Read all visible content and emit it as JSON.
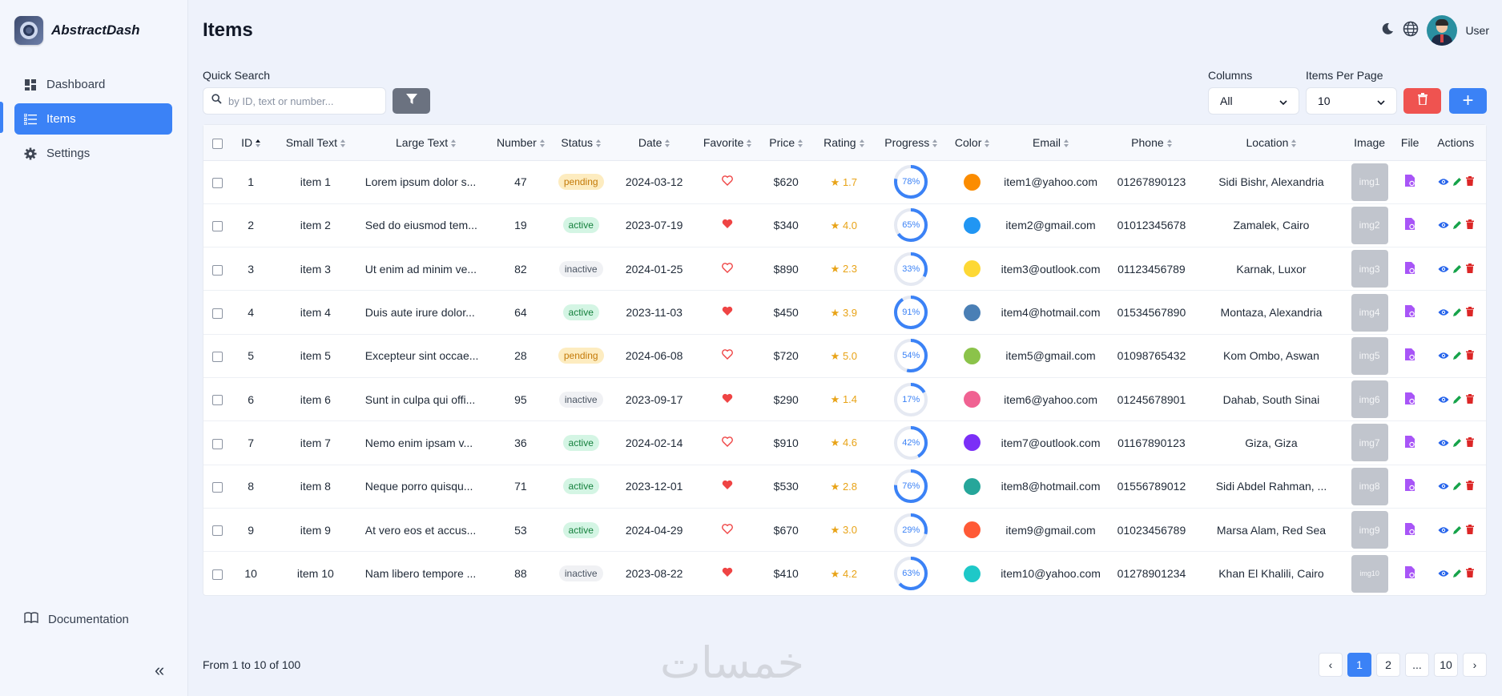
{
  "app": {
    "name": "AbstractDash"
  },
  "sidebar": {
    "items": [
      {
        "label": "Dashboard",
        "icon": "dashboard-icon",
        "active": false
      },
      {
        "label": "Items",
        "icon": "list-icon",
        "active": true
      },
      {
        "label": "Settings",
        "icon": "gear-icon",
        "active": false
      }
    ],
    "documentation_label": "Documentation",
    "collapse_icon": "«"
  },
  "header": {
    "title": "Items",
    "user_name": "User"
  },
  "toolbar": {
    "quick_search_label": "Quick Search",
    "search_placeholder": "by ID, text or number...",
    "columns_label": "Columns",
    "columns_value": "All",
    "per_page_label": "Items Per Page",
    "per_page_value": "10",
    "add_label": "+"
  },
  "table": {
    "headers": {
      "id": "ID",
      "small_text": "Small Text",
      "large_text": "Large Text",
      "number": "Number",
      "status": "Status",
      "date": "Date",
      "favorite": "Favorite",
      "price": "Price",
      "rating": "Rating",
      "progress": "Progress",
      "color": "Color",
      "email": "Email",
      "phone": "Phone",
      "location": "Location",
      "image": "Image",
      "file": "File",
      "actions": "Actions"
    },
    "rows": [
      {
        "id": "1",
        "small": "item 1",
        "large": "Lorem ipsum dolor s...",
        "number": "47",
        "status": "pending",
        "date": "2024-03-12",
        "favorite": false,
        "price": "$620",
        "rating": "1.7",
        "progress": 78,
        "progress_label": "78%",
        "color": "#fb8c00",
        "email": "item1@yahoo.com",
        "phone": "01267890123",
        "location": "Sidi Bishr, Alexandria",
        "image": "img1"
      },
      {
        "id": "2",
        "small": "item 2",
        "large": "Sed do eiusmod tem...",
        "number": "19",
        "status": "active",
        "date": "2023-07-19",
        "favorite": true,
        "price": "$340",
        "rating": "4.0",
        "progress": 65,
        "progress_label": "65%",
        "color": "#2196f3",
        "email": "item2@gmail.com",
        "phone": "01012345678",
        "location": "Zamalek, Cairo",
        "image": "img2"
      },
      {
        "id": "3",
        "small": "item 3",
        "large": "Ut enim ad minim ve...",
        "number": "82",
        "status": "inactive",
        "date": "2024-01-25",
        "favorite": false,
        "price": "$890",
        "rating": "2.3",
        "progress": 33,
        "progress_label": "33%",
        "color": "#fdd835",
        "email": "item3@outlook.com",
        "phone": "01123456789",
        "location": "Karnak, Luxor",
        "image": "img3"
      },
      {
        "id": "4",
        "small": "item 4",
        "large": "Duis aute irure dolor...",
        "number": "64",
        "status": "active",
        "date": "2023-11-03",
        "favorite": true,
        "price": "$450",
        "rating": "3.9",
        "progress": 91,
        "progress_label": "91%",
        "color": "#4a7fb5",
        "email": "item4@hotmail.com",
        "phone": "01534567890",
        "location": "Montaza, Alexandria",
        "image": "img4"
      },
      {
        "id": "5",
        "small": "item 5",
        "large": "Excepteur sint occae...",
        "number": "28",
        "status": "pending",
        "date": "2024-06-08",
        "favorite": false,
        "price": "$720",
        "rating": "5.0",
        "progress": 54,
        "progress_label": "54%",
        "color": "#8bc34a",
        "email": "item5@gmail.com",
        "phone": "01098765432",
        "location": "Kom Ombo, Aswan",
        "image": "img5"
      },
      {
        "id": "6",
        "small": "item 6",
        "large": "Sunt in culpa qui offi...",
        "number": "95",
        "status": "inactive",
        "date": "2023-09-17",
        "favorite": true,
        "price": "$290",
        "rating": "1.4",
        "progress": 17,
        "progress_label": "17%",
        "color": "#f06292",
        "email": "item6@yahoo.com",
        "phone": "01245678901",
        "location": "Dahab, South Sinai",
        "image": "img6"
      },
      {
        "id": "7",
        "small": "item 7",
        "large": "Nemo enim ipsam v...",
        "number": "36",
        "status": "active",
        "date": "2024-02-14",
        "favorite": false,
        "price": "$910",
        "rating": "4.6",
        "progress": 42,
        "progress_label": "42%",
        "color": "#7b2ff7",
        "email": "item7@outlook.com",
        "phone": "01167890123",
        "location": "Giza, Giza",
        "image": "img7"
      },
      {
        "id": "8",
        "small": "item 8",
        "large": "Neque porro quisqu...",
        "number": "71",
        "status": "active",
        "date": "2023-12-01",
        "favorite": true,
        "price": "$530",
        "rating": "2.8",
        "progress": 76,
        "progress_label": "76%",
        "color": "#26a69a",
        "email": "item8@hotmail.com",
        "phone": "01556789012",
        "location": "Sidi Abdel Rahman, ...",
        "image": "img8"
      },
      {
        "id": "9",
        "small": "item 9",
        "large": "At vero eos et accus...",
        "number": "53",
        "status": "active",
        "date": "2024-04-29",
        "favorite": false,
        "price": "$670",
        "rating": "3.0",
        "progress": 29,
        "progress_label": "29%",
        "color": "#ff5a36",
        "email": "item9@gmail.com",
        "phone": "01023456789",
        "location": "Marsa Alam, Red Sea",
        "image": "img9"
      },
      {
        "id": "10",
        "small": "item 10",
        "large": "Nam libero tempore ...",
        "number": "88",
        "status": "inactive",
        "date": "2023-08-22",
        "favorite": true,
        "price": "$410",
        "rating": "4.2",
        "progress": 63,
        "progress_label": "63%",
        "color": "#1ec8c8",
        "email": "item10@yahoo.com",
        "phone": "01278901234",
        "location": "Khan El Khalili, Cairo",
        "image": "img10"
      }
    ]
  },
  "footer": {
    "range_text": "From 1 to 10 of 100",
    "watermark": "خمسات",
    "pagination": {
      "prev": "‹",
      "pages": [
        "1",
        "2",
        "...",
        "10"
      ],
      "current": "1",
      "next": "›"
    }
  },
  "colors": {
    "accent": "#3b82f6",
    "danger": "#ef5350",
    "heart": "#ef4444",
    "star": "#e8a317",
    "file": "#a855f7",
    "view": "#2563eb",
    "edit": "#16a34a",
    "delete": "#dc2626"
  }
}
